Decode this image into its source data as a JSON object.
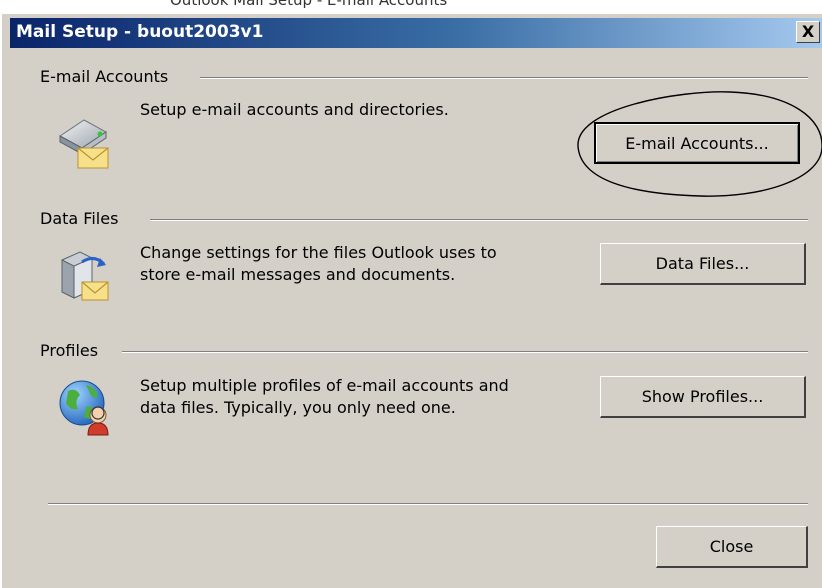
{
  "window": {
    "title": "Mail Setup - buout2003v1",
    "close_glyph": "X"
  },
  "top_strip_text": "Outlook Mail Setup - E-mail Accounts",
  "groups": {
    "email_accounts": {
      "label": "E-mail Accounts",
      "description": [
        "Setup e-mail accounts and directories."
      ],
      "button": "E-mail Accounts...",
      "icon": "mail-accounts-icon"
    },
    "data_files": {
      "label": "Data Files",
      "description": [
        "Change settings for the files Outlook uses to",
        "store e-mail messages and documents."
      ],
      "button": "Data Files...",
      "icon": "data-files-icon"
    },
    "profiles": {
      "label": "Profiles",
      "description": [
        "Setup multiple profiles of e-mail accounts and",
        "data files. Typically, you only need one."
      ],
      "button": "Show Profiles...",
      "icon": "profiles-globe-icon"
    }
  },
  "footer": {
    "close_button": "Close"
  },
  "colors": {
    "dialog_bg": "#d4d0c8",
    "titlebar_start": "#0a246a",
    "titlebar_end": "#a6caf0"
  }
}
